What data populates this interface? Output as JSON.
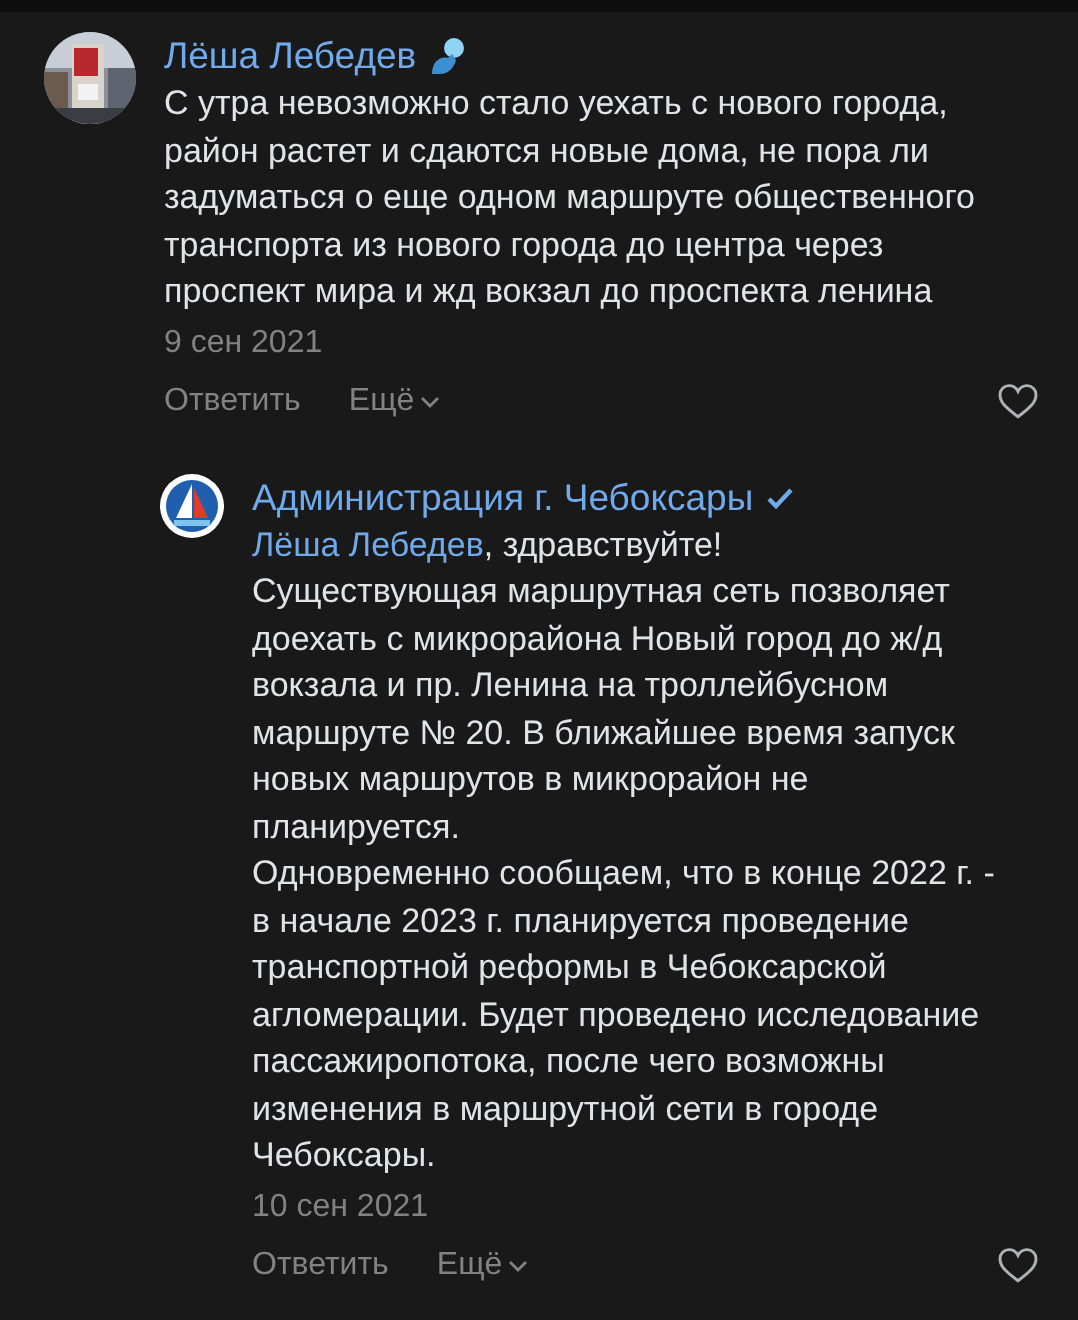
{
  "comments": [
    {
      "author": "Лёша Лебедев",
      "verified": false,
      "badge": true,
      "text": "С утра невозможно стало уехать с нового города, район растет и сдаются новые дома, не пора ли задуматься о еще одном маршруте общественного транспорта из нового города до центра через проспект мира и жд вокзал до проспекта ленина",
      "date": "9 сен 2021",
      "reply_label": "Ответить",
      "more_label": "Ещё",
      "liked": false,
      "replies": [
        {
          "author": "Администрация г. Чебоксары",
          "avatar": {
            "kind": "logo"
          },
          "verified": true,
          "badge": false,
          "mention": "Лёша Лебедев",
          "text": ", здравствуйте!\nСуществующая маршрутная сеть позволяет доехать с микрорайона Новый город до ж/д вокзала и пр. Ленина на троллейбусном маршруте № 20. В ближайшее время запуск новых маршрутов в микрорайон не планируется.\nОдновременно сообщаем, что в конце 2022 г. - в начале 2023 г. планируется проведение транспортной реформы в Чебоксарской агломерации. Будет проведено исследование пассажиропотока, после чего возможны изменения в маршрутной сети в городе Чебоксары.",
          "date": "10 сен 2021",
          "reply_label": "Ответить",
          "more_label": "Ещё",
          "liked": false
        }
      ]
    }
  ]
}
